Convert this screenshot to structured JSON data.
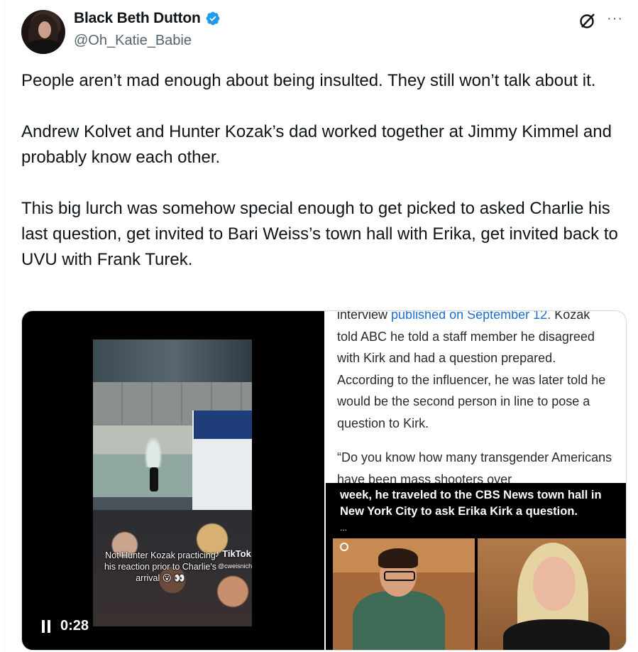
{
  "author": {
    "display_name": "Black Beth Dutton",
    "handle": "@Oh_Katie_Babie",
    "verified": true
  },
  "actions": {
    "grok_icon": "grok-icon",
    "more_icon": "more-icon",
    "more_glyph": "···"
  },
  "tweet": {
    "paragraphs": [
      "People aren’t mad enough about being insulted. They still won’t talk about it.",
      "Andrew Kolvet and Hunter Kozak’s dad worked together at Jimmy Kimmel and probably know each other.",
      "This big lurch was somehow special enough to get picked to asked Charlie his last question, get invited to Bari Weiss’s town hall with Erika, get invited back to UVU with Frank Turek."
    ]
  },
  "media": {
    "video": {
      "caption": "Not Hunter Kozak practicing his reaction prior to Charlie's arrival 😮 👀",
      "tiktok_label": "TikTok",
      "tiktok_user": "@cweisnicht",
      "time": "0:28"
    },
    "article": {
      "line1_prefix": "interview ",
      "line1_link": "published on September 12.",
      "line1_suffix": " Kozak told ABC he told a staff member he disagreed with Kirk and had a question prepared. According to the influencer, he was later told he would be the second person in line to pose a question to Kirk.",
      "quote": "“Do you know how many transgender Americans have been mass shooters over"
    },
    "cbs": {
      "text": "week, he traveled to the CBS News town hall in New York City to ask Erika Kirk a question.",
      "dots": "..."
    }
  },
  "colors": {
    "verified_blue": "#1d9bf0",
    "link_blue": "#1d6fd1",
    "secondary_text": "#536471"
  }
}
